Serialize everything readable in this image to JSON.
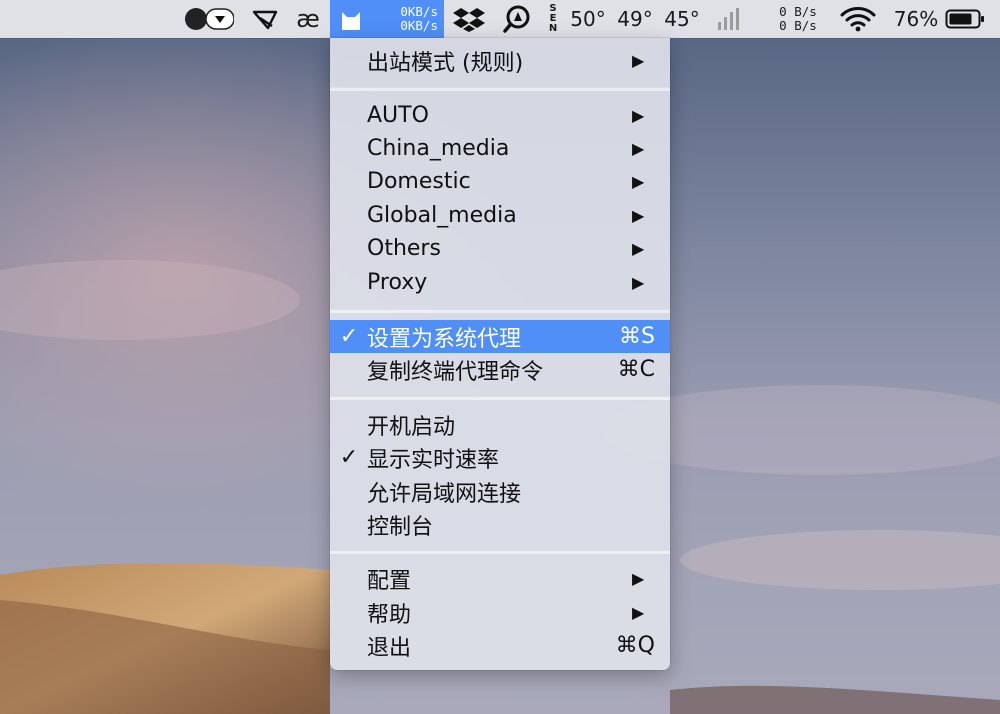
{
  "menubar": {
    "net_up": "0KB/s",
    "net_down": "0KB/s",
    "ae_glyph": "æ",
    "weather_dir": [
      "S",
      "E",
      "N"
    ],
    "temps": [
      "50°",
      "49°",
      "45°"
    ],
    "speed_up": "0 B/s",
    "speed_down": "0 B/s",
    "battery": "76%"
  },
  "menu": {
    "mode": {
      "label": "出站模式 (规则)"
    },
    "groups": [
      {
        "label": "AUTO"
      },
      {
        "label": "China_media"
      },
      {
        "label": "Domestic"
      },
      {
        "label": "Global_media"
      },
      {
        "label": "Others"
      },
      {
        "label": "Proxy"
      }
    ],
    "system_proxy": {
      "label": "设置为系统代理",
      "shortcut": "⌘S",
      "checked": true
    },
    "copy_cmd": {
      "label": "复制终端代理命令",
      "shortcut": "⌘C"
    },
    "options": [
      {
        "label": "开机启动",
        "checked": false
      },
      {
        "label": "显示实时速率",
        "checked": true
      },
      {
        "label": "允许局域网连接",
        "checked": false
      },
      {
        "label": "控制台",
        "checked": false
      }
    ],
    "config": {
      "label": "配置"
    },
    "help": {
      "label": "帮助"
    },
    "quit": {
      "label": "退出",
      "shortcut": "⌘Q"
    },
    "check_glyph": "✓",
    "arrow_glyph": "▶"
  },
  "colors": {
    "highlight": "#4f8ff7",
    "menubar_bg": "#ececf0"
  }
}
